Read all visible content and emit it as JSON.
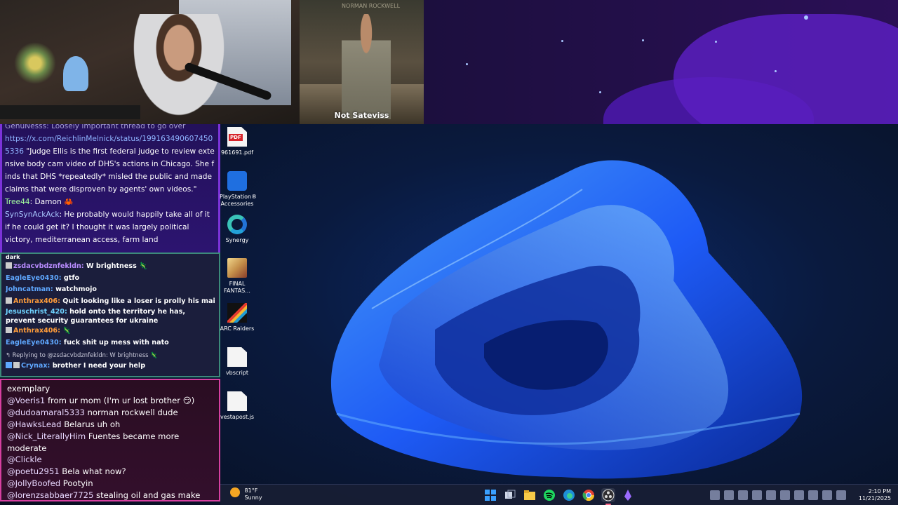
{
  "video": {
    "title_faint": "NORMAN ROCKWELL",
    "caption": "Not Sateviss"
  },
  "chat1": {
    "faded_line": "GenuNesss: Loosely important thread to go over",
    "link": "https://x.com/ReichlinMelnick/status/1991634906074505336",
    "quote": "\"Judge Ellis is the first federal judge to review extensive body cam video of DHS's actions in Chicago. She finds that DHS *repeatedly* misled the public and made claims that were disproven by agents' own videos.\"",
    "msgs": [
      {
        "user": "Tree44",
        "text": ": Damon 🦀"
      },
      {
        "user": "SynSynAckAck",
        "text": ": He probably would happily take all of it if he could get it? I thought it was largely political victory, mediterranean access, farm land"
      }
    ]
  },
  "chat2": {
    "top_fragment": "dark",
    "msgs": [
      {
        "user": "zsdacvbdznfekldn:",
        "text": "W brightness 🦎"
      },
      {
        "user": "EagleEye0430:",
        "text": "gtfo"
      },
      {
        "user": "Johncatman:",
        "text": "watchmojo"
      },
      {
        "user": "Anthrax406:",
        "text": "Quit looking like a loser is prolly his main goal rn"
      },
      {
        "user": "Jesuschrist_420:",
        "text": "hold onto the territory he has, prevent security guarantees for ukraine"
      },
      {
        "user": "Anthrax406:",
        "text": "🦎"
      },
      {
        "user": "EagleEye0430:",
        "text": "fuck shit up mess with nato"
      },
      {
        "user": "Crynax:",
        "text": "brother I need your help"
      }
    ],
    "reply": "↰ Replying to @zsdacvbdznfekldn: W brightness 🦎"
  },
  "chat3": {
    "lines": [
      {
        "user": "",
        "text": "exemplary"
      },
      {
        "user": "@Voeris1",
        "text": " from ur mom (I'm ur lost brother 😏)"
      },
      {
        "user": "@dudoamaral5333",
        "text": " norman rockwell dude"
      },
      {
        "user": "@HawksLead",
        "text": " Belarus uh oh"
      },
      {
        "user": "@Nick_LiterallyHim",
        "text": " Fuentes became more moderate"
      },
      {
        "user": "@Clickle",
        "text": ""
      },
      {
        "user": "@poetu2951",
        "text": " Bela what now?"
      },
      {
        "user": "@JollyBoofed",
        "text": " Pootyin"
      },
      {
        "user": "@lorenzsabbaer7725",
        "text": " stealing oil and gas make sure he dictates the prices"
      }
    ]
  },
  "desktop_icons": [
    {
      "label": "961691.pdf",
      "kind": "pdf-icon"
    },
    {
      "label": "PlayStation® Accessories",
      "kind": "playstation-icon"
    },
    {
      "label": "Synergy",
      "kind": "synergy-icon"
    },
    {
      "label": "FINAL FANTAS...",
      "kind": "final-fantasy-icon"
    },
    {
      "label": "ARC Raiders",
      "kind": "arc-raiders-icon"
    },
    {
      "label": "vbscript",
      "kind": "file-icon"
    },
    {
      "label": "vestapost.js",
      "kind": "file-icon"
    }
  ],
  "taskbar": {
    "weather_temp": "81°F",
    "weather_desc": "Sunny",
    "time": "2:10 PM",
    "date": "11/21/2025",
    "apps": [
      "windows-start-icon",
      "task-view-icon",
      "file-explorer-icon",
      "spotify-icon",
      "edge-icon",
      "chrome-icon",
      "obs-icon",
      "app-icon"
    ]
  },
  "colors": {
    "wallpaper_blue": "#1f5eff",
    "chat2_border": "#3c8a7a",
    "chat3_border": "#d63fa0"
  }
}
